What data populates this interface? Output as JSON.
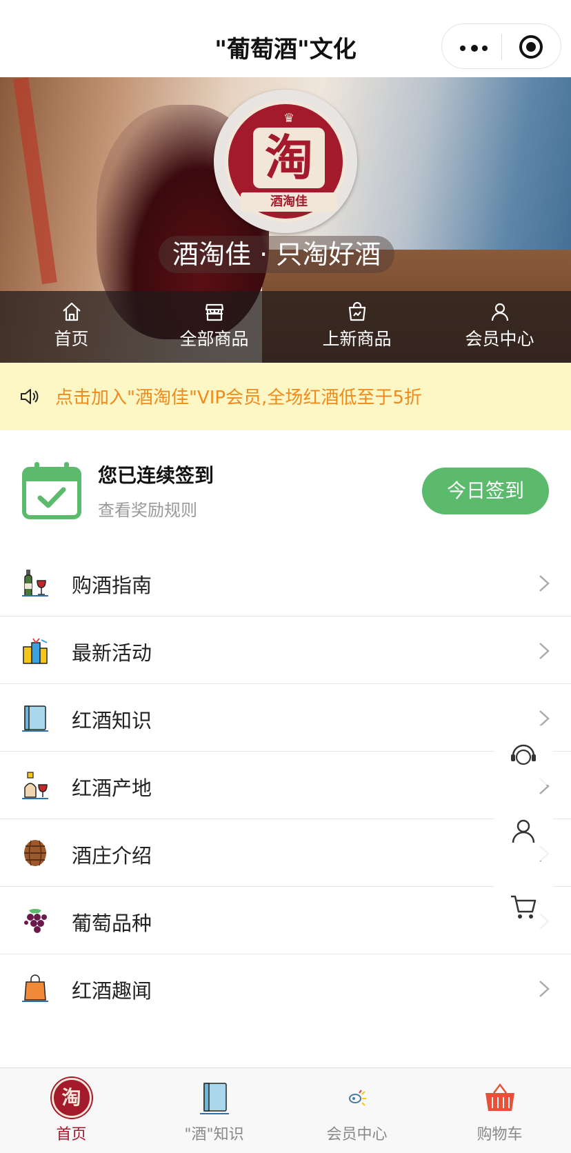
{
  "app": {
    "title": "\"葡萄酒\"文化"
  },
  "hero": {
    "logo_char": "淘",
    "logo_ribbon": "酒淘佳",
    "slogan": "酒淘佳 · 只淘好酒",
    "nav": [
      {
        "label": "首页",
        "icon": "home-icon"
      },
      {
        "label": "全部商品",
        "icon": "store-icon"
      },
      {
        "label": "上新商品",
        "icon": "new-bag-icon"
      },
      {
        "label": "会员中心",
        "icon": "user-icon"
      }
    ]
  },
  "notice": {
    "text": "点击加入\"酒淘佳\"VIP会员,全场红酒低至于5折",
    "icon": "speaker-icon"
  },
  "signin": {
    "heading": "您已连续签到",
    "sub": "查看奖励规则",
    "button": "今日签到",
    "icon": "calendar-check-icon"
  },
  "menu": [
    {
      "label": "购酒指南",
      "icon": "wine-bottle-glass-icon"
    },
    {
      "label": "最新活动",
      "icon": "gift-icon"
    },
    {
      "label": "红酒知识",
      "icon": "book-icon"
    },
    {
      "label": "红酒产地",
      "icon": "bottle-origin-icon"
    },
    {
      "label": "酒庄介绍",
      "icon": "barrel-icon"
    },
    {
      "label": "葡萄品种",
      "icon": "grapes-icon"
    },
    {
      "label": "红酒趣闻",
      "icon": "shopping-bag-icon"
    }
  ],
  "tabbar": [
    {
      "label": "首页",
      "icon": "home-logo-icon",
      "active": true
    },
    {
      "label": "\"酒\"知识",
      "icon": "book-icon",
      "active": false
    },
    {
      "label": "会员中心",
      "icon": "member-icon",
      "active": false
    },
    {
      "label": "购物车",
      "icon": "basket-icon",
      "active": false
    }
  ],
  "colors": {
    "accent_green": "#5cba6d",
    "brand_red": "#a31a2c",
    "notice_bg": "#fdf7c6",
    "notice_text": "#f08a1c"
  }
}
